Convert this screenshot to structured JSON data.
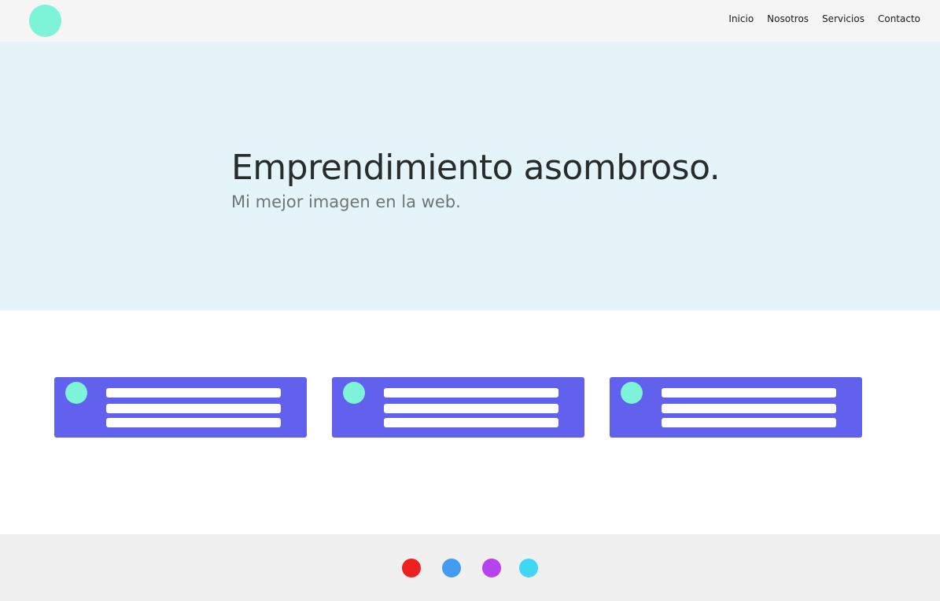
{
  "nav": {
    "links": [
      "Inicio",
      "Nosotros",
      "Servicios",
      "Contacto"
    ]
  },
  "hero": {
    "title": "Emprendimiento asombroso.",
    "subtitle": "Mi mejor imagen en la web."
  },
  "cards": [
    {
      "placeholder_lines": 3
    },
    {
      "placeholder_lines": 3
    },
    {
      "placeholder_lines": 3
    }
  ],
  "footer": {
    "social_icons": [
      "red-circle-icon",
      "blue-circle-icon",
      "purple-circle-icon",
      "cyan-circle-icon"
    ]
  },
  "colors": {
    "navbar_bg": "#f5f5f5",
    "logo": "#7df3d8",
    "hero_bg": "#e4f4f8",
    "card_bg": "#6161ee",
    "card_accent": "#7df3d8",
    "footer_bg": "#f0f0f0",
    "social_red": "#f02020",
    "social_blue": "#429cf0",
    "social_purple": "#b642f0",
    "social_cyan": "#42d6f5"
  }
}
